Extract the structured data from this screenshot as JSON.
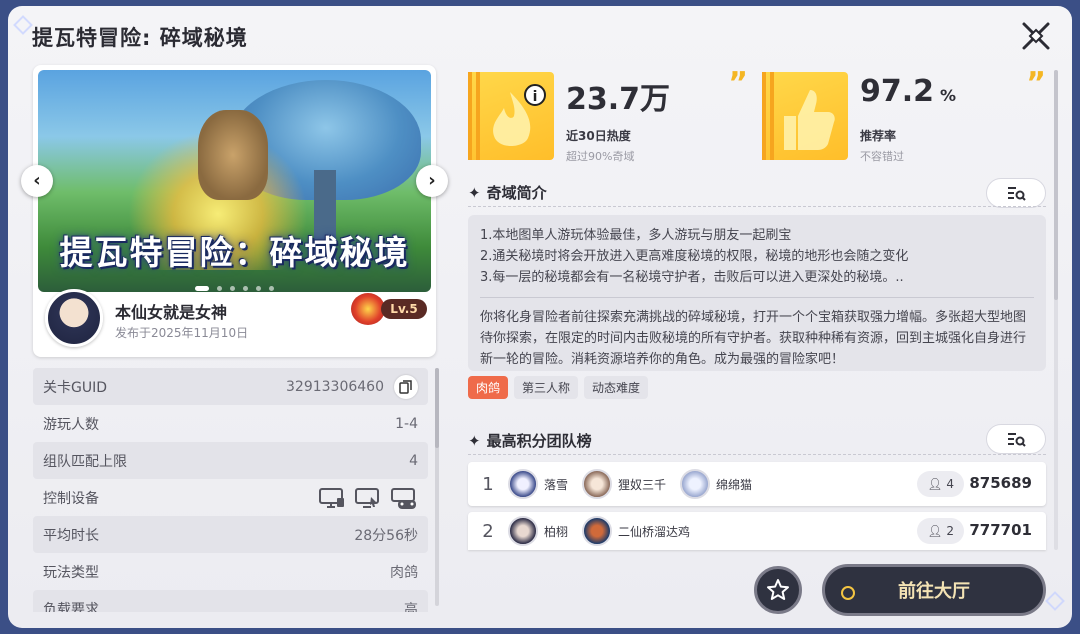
{
  "window": {
    "title": "提瓦特冒险: 碎域秘境"
  },
  "banner": {
    "title": "提瓦特冒险：碎域秘境",
    "page_count": 6,
    "current_page": 1
  },
  "author": {
    "name": "本仙女就是女神",
    "published": "发布于2025年11月10日",
    "level": "Lv.5"
  },
  "info": {
    "rows": [
      {
        "label": "关卡GUID",
        "value": "32913306460"
      },
      {
        "label": "游玩人数",
        "value": "1-4"
      },
      {
        "label": "组队匹配上限",
        "value": "4"
      },
      {
        "label": "控制设备",
        "value": ""
      },
      {
        "label": "平均时长",
        "value": "28分56秒"
      },
      {
        "label": "玩法类型",
        "value": "肉鸽"
      },
      {
        "label": "负载要求",
        "value": "高"
      }
    ],
    "device_icons": [
      "pc-icon",
      "mobile-icon",
      "gamepad-icon"
    ]
  },
  "stats": {
    "heat": {
      "value": "23.7万",
      "label": "近30日热度",
      "sub": "超过90%奇域"
    },
    "recommend": {
      "value": "97.2",
      "unit": "%",
      "label": "推荐率",
      "sub": "不容错过"
    }
  },
  "intro": {
    "heading": "奇域简介",
    "lines": [
      "1.本地图单人游玩体验最佳，多人游玩与朋友一起刷宝",
      "2.通关秘境时将会开放进入更高难度秘境的权限，秘境的地形也会随之变化",
      "3.每一层的秘境都会有一名秘境守护者，击败后可以进入更深处的秘境。.."
    ],
    "paragraph": "你将化身冒险者前往探索充满挑战的碎域秘境，打开一个个宝箱获取强力增幅。多张超大型地图待你探索，在限定的时间内击败秘境的所有守护者。获取种种稀有资源，回到主城强化自身进行新一轮的冒险。消耗资源培养你的角色。成为最强的冒险家吧！",
    "tags": [
      "肉鸽",
      "第三人称",
      "动态难度"
    ]
  },
  "leaderboard": {
    "heading": "最高积分团队榜",
    "rows": [
      {
        "rank": "1",
        "members": [
          "落雪",
          "狸奴三千",
          "绵绵猫"
        ],
        "count": "4",
        "score": "875689"
      },
      {
        "rank": "2",
        "members": [
          "柏栩",
          "二仙桥溜达鸡"
        ],
        "count": "2",
        "score": "777701"
      }
    ]
  },
  "actions": {
    "go_label": "前往大厅"
  },
  "colors": {
    "accent": "#f4b624",
    "tag_hot": "#ef6b4a",
    "button_dark": "#2f3240"
  }
}
